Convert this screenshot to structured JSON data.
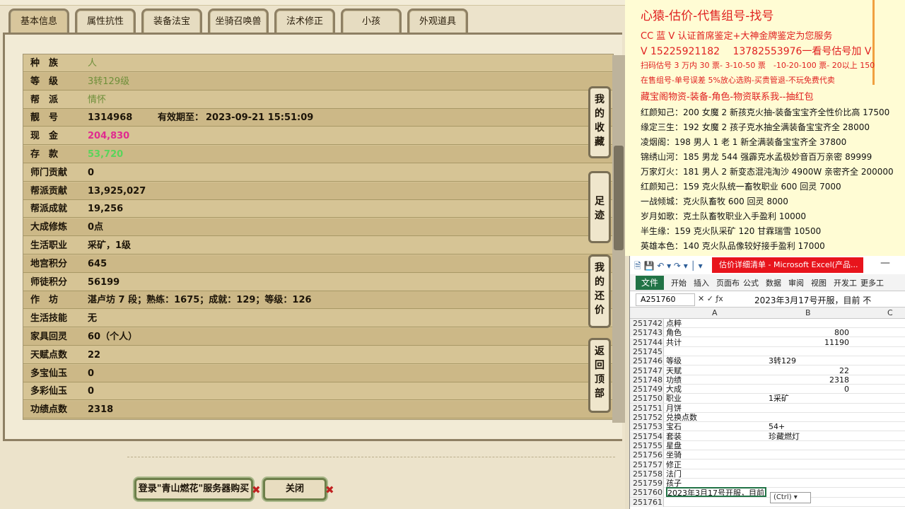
{
  "tabs": [
    "基本信息",
    "属性抗性",
    "装备法宝",
    "坐骑召唤兽",
    "法术修正",
    "小孩",
    "外观道具"
  ],
  "active_tab": "基本信息",
  "stats": [
    {
      "label": "种　族",
      "value": "人",
      "style": "green"
    },
    {
      "label": "等　级",
      "value": "3转129级",
      "style": "green"
    },
    {
      "label": "帮　派",
      "value": "情怀",
      "style": "green"
    },
    {
      "label": "靓　号",
      "value": "1314968",
      "extra_label": "有效期至：",
      "extra_value": "2023-09-21 15:51:09"
    },
    {
      "label": "现　金",
      "value": "204,830",
      "style": "pink"
    },
    {
      "label": "存　款",
      "value": "53,720",
      "style": "lime"
    },
    {
      "label": "师门贡献",
      "value": "0"
    },
    {
      "label": "帮派贡献",
      "value": "13,925,027"
    },
    {
      "label": "帮派成就",
      "value": "19,256"
    },
    {
      "label": "大成修炼",
      "value": "0点"
    },
    {
      "label": "生活职业",
      "value": "采矿，1级"
    },
    {
      "label": "地宫积分",
      "value": "645"
    },
    {
      "label": "师徒积分",
      "value": "56199"
    },
    {
      "label": "作　坊",
      "value": "湛卢坊 7 段；熟练：1675；成就：129；等级：126"
    },
    {
      "label": "生活技能",
      "value": "无"
    },
    {
      "label": "家具回灵",
      "value": "60（个人）"
    },
    {
      "label": "天赋点数",
      "value": "22"
    },
    {
      "label": "多宝仙玉",
      "value": "0"
    },
    {
      "label": "多彩仙玉",
      "value": "0"
    },
    {
      "label": "功绩点数",
      "value": "2318"
    }
  ],
  "side_buttons": [
    "我的收藏",
    "足迹",
    "我的还价",
    "返回顶部"
  ],
  "bottom_buttons": {
    "buy": "登录\"青山燃花\"服务器购买",
    "close": "关闭"
  },
  "chat": {
    "title": "心猿-估价-代售组号-找号",
    "lines": [
      "CC 蓝 V 认证首席鉴定+大神金牌鉴定为您服务",
      "V 15225921182　 13782553976一看号估号加 V",
      "扫码估号 3 万内 30 票- 3-10-50 票　-10-20-100 票- 20以上 150",
      "在售组号-单号误差 5%放心选购-买贵管退-不玩免费代卖",
      "藏宝阁物资-装备-角色-物资联系我--抽红包"
    ],
    "listings": [
      "红颜知己：200 女魔 2 新孩克火抽-装备宝宝齐全性价比高 17500",
      "缘定三生：192 女魔 2 孩子克水抽全满装备宝宝齐全 28000",
      "凌烟阁：198 男人 1 老 1 新全满装备宝宝齐全 37800",
      "锦绣山河：185 男龙 544 强霹克水孟极妙音百万亲密 89999",
      "万家灯火：181 男人 2 新变态混沌淘沙 4900W 亲密齐全 200000",
      "红颜知己：159 克火队统一畜牧职业 600 回灵 7000",
      "一战倾城：克火队畜牧 600 回灵 8000",
      "岁月如歌：克土队畜牧职业入手盈利 10000",
      "半生缘：159 克火队采矿 120 甘霖瑞雪 10500",
      "英雄本色：140 克火队品像较好接手盈利 17000"
    ]
  },
  "excel": {
    "title": "估价详细清单 - Microsoft Excel(产品...",
    "ribbon_tabs": [
      "文件",
      "开始",
      "插入",
      "页面布",
      "公式",
      "数据",
      "审阅",
      "视图",
      "开发工",
      "更多工"
    ],
    "name_box": "A251760",
    "formula_text": "2023年3月17号开服，目前  不",
    "columns": [
      "A",
      "B",
      "C"
    ],
    "rows": [
      {
        "n": "251742",
        "a": "点粹",
        "b": ""
      },
      {
        "n": "251743",
        "a": "角色",
        "b": "800"
      },
      {
        "n": "251744",
        "a": "共计",
        "b": "11190"
      },
      {
        "n": "251745",
        "a": "",
        "b": ""
      },
      {
        "n": "251746",
        "a": "等级",
        "b": "3转129",
        "b_left": true
      },
      {
        "n": "251747",
        "a": "天赋",
        "b": "22"
      },
      {
        "n": "251748",
        "a": "功绩",
        "b": "2318"
      },
      {
        "n": "251749",
        "a": "大成",
        "b": "0"
      },
      {
        "n": "251750",
        "a": "职业",
        "b": "1采矿",
        "b_left": true
      },
      {
        "n": "251751",
        "a": "月饼",
        "b": ""
      },
      {
        "n": "251752",
        "a": "兑换点数",
        "b": ""
      },
      {
        "n": "251753",
        "a": "宝石",
        "b": "54+",
        "b_left": true
      },
      {
        "n": "251754",
        "a": "套装",
        "b": "珍藏燃灯",
        "b_left": true
      },
      {
        "n": "251755",
        "a": "星盘",
        "b": ""
      },
      {
        "n": "251756",
        "a": "坐骑",
        "b": ""
      },
      {
        "n": "251757",
        "a": "修正",
        "b": ""
      },
      {
        "n": "251758",
        "a": "法门",
        "b": ""
      },
      {
        "n": "251759",
        "a": "孩子",
        "b": ""
      },
      {
        "n": "251760",
        "a": "2023年3月17号开服，目前  不",
        "b": "",
        "selected": true
      },
      {
        "n": "251761",
        "a": "",
        "b": ""
      }
    ],
    "paste_hint": "(Ctrl) ▾"
  }
}
